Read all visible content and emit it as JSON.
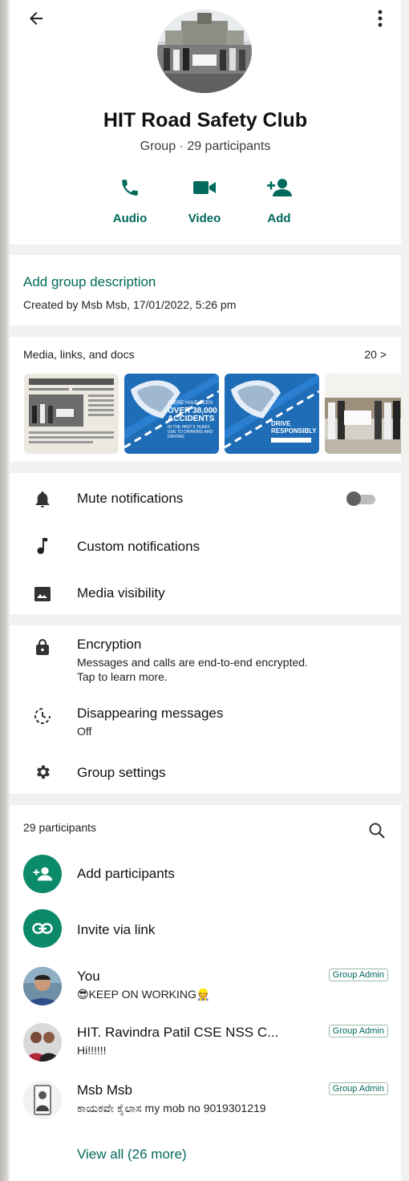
{
  "header": {
    "group_name": "HIT Road Safety Club",
    "group_info": "Group · 29 participants"
  },
  "actions": [
    {
      "label": "Audio",
      "icon": "phone-icon"
    },
    {
      "label": "Video",
      "icon": "video-camera-icon"
    },
    {
      "label": "Add",
      "icon": "add-person-icon"
    }
  ],
  "description": {
    "add_link": "Add group description",
    "created": "Created by Msb Msb, 17/01/2022, 5:26 pm"
  },
  "media": {
    "title": "Media, links, and docs",
    "count": "20 >",
    "thumbs": [
      {
        "kind": "newspaper"
      },
      {
        "kind": "poster",
        "text_top": "THERE HAVE BEEN",
        "text_big": "OVER 38,000 ACCIDENTS",
        "text_small": "IN THE PAST 5 YEARS DUE TO DRINKING AND DRIVING"
      },
      {
        "kind": "poster",
        "text_big": "DRIVE RESPONSIBLY"
      },
      {
        "kind": "photo"
      }
    ]
  },
  "settings": {
    "mute": "Mute notifications",
    "custom": "Custom notifications",
    "visibility": "Media visibility",
    "encryption_title": "Encryption",
    "encryption_sub1": "Messages and calls are end-to-end encrypted.",
    "encryption_sub2": "Tap to learn more.",
    "disappearing_title": "Disappearing messages",
    "disappearing_sub": "Off",
    "group_settings": "Group settings"
  },
  "participants": {
    "count_label": "29 participants",
    "add": "Add participants",
    "invite": "Invite via link",
    "list": [
      {
        "name": "You",
        "status": "😎KEEP ON WORKING👷",
        "badge": "Group Admin"
      },
      {
        "name": "HIT. Ravindra Patil CSE NSS C...",
        "status": "Hi!!!!!!",
        "badge": "Group Admin"
      },
      {
        "name": "Msb Msb",
        "status": "ಕಾಯಕವೇ ಕೈಲಾಸ my mob no 9019301219",
        "badge": "Group Admin"
      }
    ],
    "view_all": "View all (26 more)"
  },
  "colors": {
    "accent": "#00695c",
    "fab_green": "#0b8a69",
    "poster_blue": "#1f6db7"
  }
}
